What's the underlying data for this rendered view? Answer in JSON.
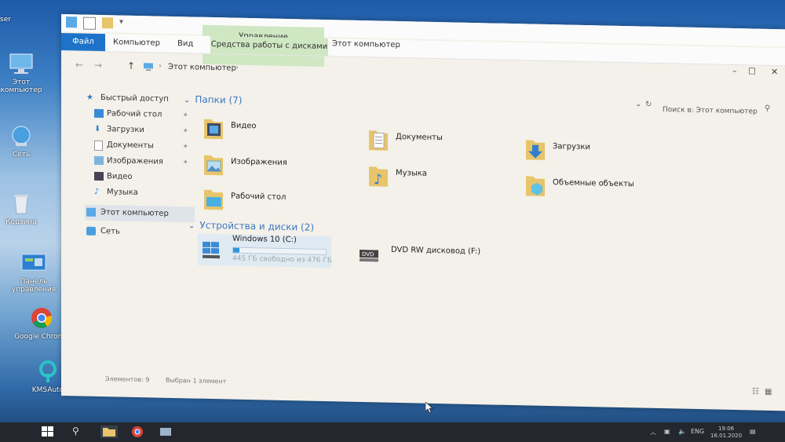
{
  "desktop": {
    "icons": [
      {
        "label": "Этот компьютер",
        "icon": "computer-icon"
      },
      {
        "label": "Сеть",
        "icon": "network-icon"
      },
      {
        "label": "Корзина",
        "icon": "recycle-bin-icon"
      },
      {
        "label": "Панель управления",
        "icon": "control-panel-icon"
      },
      {
        "label": "Google Chrome",
        "icon": "chrome-icon"
      },
      {
        "label": "KMSAuto",
        "icon": "app-icon"
      }
    ],
    "partial_label": "ser"
  },
  "ribbon": {
    "file_tab": "Файл",
    "tabs": [
      "Компьютер",
      "Вид"
    ],
    "manage_label": "Управление",
    "disk_tools_label": "Средства работы с дисками"
  },
  "window": {
    "title": "Этот компьютер",
    "minimize": "–",
    "maximize": "☐",
    "close": "✕"
  },
  "address": {
    "back": "←",
    "forward": "→",
    "up": "↑",
    "crumb": "Этот компьютер",
    "crumb_sep": "›",
    "search_placeholder": "Поиск в: Этот компьютер"
  },
  "sidebar": {
    "items": [
      {
        "label": "Быстрый доступ",
        "icon": "star-icon",
        "pinned": false
      },
      {
        "label": "Рабочий стол",
        "icon": "desktop-icon",
        "pinned": true
      },
      {
        "label": "Загрузки",
        "icon": "downloads-icon",
        "pinned": true
      },
      {
        "label": "Документы",
        "icon": "documents-icon",
        "pinned": true
      },
      {
        "label": "Изображения",
        "icon": "images-icon",
        "pinned": true
      },
      {
        "label": "Видео",
        "icon": "video-icon",
        "pinned": false
      },
      {
        "label": "Музыка",
        "icon": "music-icon",
        "pinned": false
      },
      {
        "label": "Этот компьютер",
        "icon": "computer-icon",
        "pinned": false
      },
      {
        "label": "Сеть",
        "icon": "network-icon",
        "pinned": false
      }
    ]
  },
  "content": {
    "folders_header": "Папки (7)",
    "folders": [
      {
        "label": "Видео",
        "icon": "video-folder-icon"
      },
      {
        "label": "Документы",
        "icon": "documents-folder-icon"
      },
      {
        "label": "Загрузки",
        "icon": "downloads-folder-icon"
      },
      {
        "label": "Изображения",
        "icon": "images-folder-icon"
      },
      {
        "label": "Музыка",
        "icon": "music-folder-icon"
      },
      {
        "label": "Объемные объекты",
        "icon": "3d-objects-folder-icon"
      },
      {
        "label": "Рабочий стол",
        "icon": "desktop-folder-icon"
      }
    ],
    "devices_header": "Устройства и диски (2)",
    "drives": [
      {
        "label": "Windows 10 (C:)",
        "sub": "445 ГБ свободно из 476 ГБ",
        "usage_fraction": 0.065,
        "icon": "windows-drive-icon"
      },
      {
        "label": "DVD RW дисковод (F:)",
        "sub": "",
        "icon": "dvd-drive-icon"
      }
    ]
  },
  "status": {
    "items": "Элементов: 9",
    "selected": "Выбран 1 элемент"
  },
  "taskbar": {
    "lang": "ENG",
    "time": "19:06",
    "date": "16.01.2020"
  },
  "colors": {
    "accent": "#1e73c9",
    "manage_tab": "#cfe7c2",
    "group_header": "#3a77c2",
    "folder": "#e8c46a"
  }
}
